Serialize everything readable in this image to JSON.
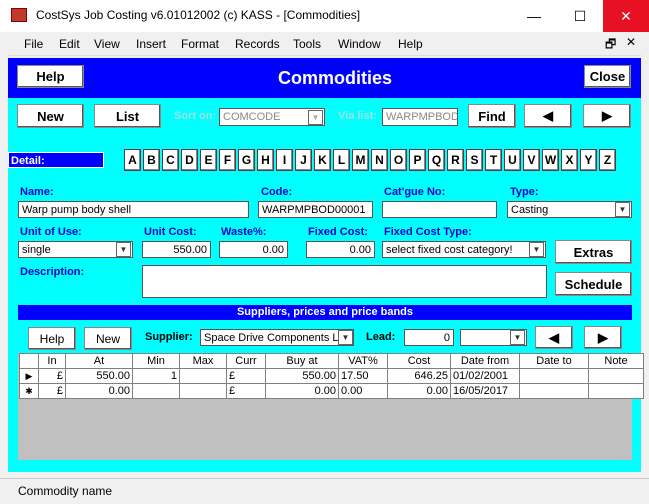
{
  "window": {
    "title": "CostSys Job Costing v6.01012002 (c) KASS - [Commodities]",
    "min": "—",
    "max": "☐",
    "close": "✕"
  },
  "menu": [
    "File",
    "Edit",
    "View",
    "Insert",
    "Format",
    "Records",
    "Tools",
    "Window",
    "Help"
  ],
  "menu_controls": {
    "restore": "🗗",
    "close": "✕"
  },
  "header": {
    "help": "Help",
    "title": "Commodities",
    "close": "Close"
  },
  "toolbar": {
    "new": "New",
    "list": "List",
    "sort_label": "Sort on:",
    "sort_value": "COMCODE",
    "via_label": "Via list:",
    "via_value": "WARPMPBOD",
    "find": "Find",
    "prev": "◀",
    "next": "▶"
  },
  "detail_label": "Detail:",
  "letters": [
    "A",
    "B",
    "C",
    "D",
    "E",
    "F",
    "G",
    "H",
    "I",
    "J",
    "K",
    "L",
    "M",
    "N",
    "O",
    "P",
    "Q",
    "R",
    "S",
    "T",
    "U",
    "V",
    "W",
    "X",
    "Y",
    "Z"
  ],
  "fields": {
    "name_label": "Name:",
    "name": "Warp pump body shell",
    "code_label": "Code:",
    "code": "WARPMPBOD00001",
    "catalogue_label": "Cat'gue No:",
    "catalogue": "",
    "type_label": "Type:",
    "type": "Casting",
    "unit_label": "Unit of Use:",
    "unit": "single",
    "cost_label": "Unit Cost:",
    "cost": "550.00",
    "waste_label": "Waste%:",
    "waste": "0.00",
    "fixed_label": "Fixed Cost:",
    "fixed": "0.00",
    "fixed_type_label": "Fixed Cost Type:",
    "fixed_type": "select fixed cost category!",
    "desc_label": "Description:",
    "desc": ""
  },
  "side_buttons": {
    "extras": "Extras",
    "schedule": "Schedule"
  },
  "suppliers": {
    "band": "Suppliers, prices and price bands",
    "help": "Help",
    "new": "New",
    "supplier_label": "Supplier:",
    "supplier": "Space Drive Components Lt",
    "lead_label": "Lead:",
    "lead": "0",
    "lead_unit": "",
    "prev": "◀",
    "next": "▶",
    "columns": [
      "In",
      "At",
      "Min",
      "Max",
      "Curr",
      "Buy at",
      "VAT%",
      "Cost",
      "Date from",
      "Date to",
      "Note"
    ],
    "rows": [
      {
        "marker": "▶",
        "in": "£",
        "at": "550.00",
        "min": "1",
        "max": "",
        "curr": "£",
        "buy": "550.00",
        "vat": "17.50",
        "cost": "646.25",
        "from": "01/02/2001",
        "to": "",
        "note": ""
      },
      {
        "marker": "✱",
        "in": "£",
        "at": "0.00",
        "min": "",
        "max": "",
        "curr": "£",
        "buy": "0.00",
        "vat": "0.00",
        "cost": "0.00",
        "from": "16/05/2017",
        "to": "",
        "note": ""
      }
    ]
  },
  "status": "Commodity name"
}
